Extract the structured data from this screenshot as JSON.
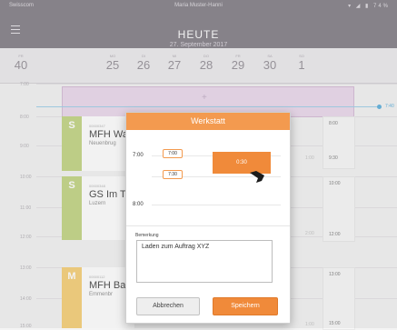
{
  "status_bar": {
    "left": "Swisscom",
    "center": "Maria Muster-Hanni",
    "right": "▾ ◢ ▮ 74%"
  },
  "header": {
    "title": "HEUTE",
    "subtitle": "27. September 2017"
  },
  "week": [
    {
      "name": "FR",
      "num": "40"
    },
    {
      "name": "MO",
      "num": "25"
    },
    {
      "name": "DI",
      "num": "26"
    },
    {
      "name": "MI",
      "num": "27"
    },
    {
      "name": "DO",
      "num": "28"
    },
    {
      "name": "FR",
      "num": "29"
    },
    {
      "name": "SA",
      "num": "30"
    },
    {
      "name": "SO",
      "num": "1"
    }
  ],
  "times": [
    "7:00",
    "8:00",
    "9:00",
    "10:00",
    "11:00",
    "12:00",
    "13:00",
    "14:00",
    "15:00"
  ],
  "now_label": "7:40",
  "entries": [
    {
      "badge": "S",
      "color": "#c8d98e",
      "number": "00000347",
      "title": "MFH Wa",
      "location": "Neuenbrug"
    },
    {
      "badge": "S",
      "color": "#c8d98e",
      "number": "00000348",
      "title": "GS Im T",
      "location": "Luzern"
    },
    {
      "badge": "M",
      "color": "#f7d382",
      "number": "00000112",
      "title": "MFH Ba",
      "location": "Emmenbr"
    }
  ],
  "right_column": [
    "8:00",
    "9:30",
    "10:00",
    "12:00",
    "13:00",
    "15:00"
  ],
  "faint_times": [
    "1:00",
    "2:00",
    "1:00"
  ],
  "dialog": {
    "title": "Werkstatt",
    "time_top": "7:00",
    "start_value": "7:00",
    "end_value": "7:30",
    "block_label": "0:30",
    "time_bottom": "8:00",
    "remark_label": "Bemerkung",
    "remark_text": "Laden zum Auftrag XYZ",
    "cancel_label": "Abbrechen",
    "save_label": "Speichern"
  },
  "colors": {
    "header": "#8e8a91",
    "accent": "#f08a3a",
    "now": "#6bb7e0"
  }
}
